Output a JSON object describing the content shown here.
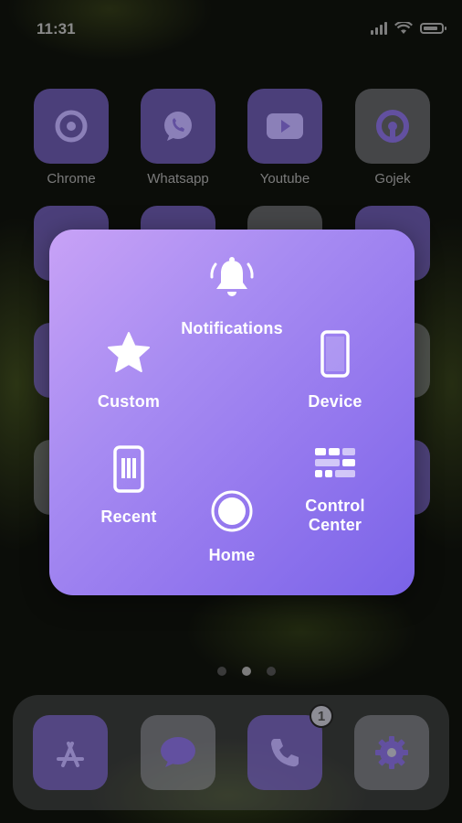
{
  "status_bar": {
    "time": "11:31"
  },
  "home_screen": {
    "apps_row1": [
      {
        "label": "Chrome",
        "icon": "chrome-icon"
      },
      {
        "label": "Whatsapp",
        "icon": "whatsapp-icon"
      },
      {
        "label": "Youtube",
        "icon": "youtube-icon"
      },
      {
        "label": "Gojek",
        "icon": "gojek-icon"
      }
    ]
  },
  "assistive_menu": {
    "notifications": {
      "label": "Notifications",
      "icon": "bell-icon"
    },
    "custom": {
      "label": "Custom",
      "icon": "star-icon"
    },
    "device": {
      "label": "Device",
      "icon": "phone-device-icon"
    },
    "recent": {
      "label": "Recent",
      "icon": "recent-apps-icon"
    },
    "home": {
      "label": "Home",
      "icon": "home-button-icon"
    },
    "control_center": {
      "label": "Control\nCenter",
      "icon": "control-center-icon"
    }
  },
  "page_indicator": {
    "pages": 3,
    "current": 2
  },
  "dock": {
    "apps": [
      {
        "name": "App Store",
        "icon": "app-store-icon"
      },
      {
        "name": "Messages",
        "icon": "messages-icon"
      },
      {
        "name": "Phone",
        "icon": "phone-icon",
        "badge": "1"
      },
      {
        "name": "Settings",
        "icon": "gear-icon"
      }
    ]
  },
  "colors": {
    "panel_start": "#c8a2f6",
    "panel_end": "#7a63e8",
    "icon_purple": "#6250a0"
  }
}
